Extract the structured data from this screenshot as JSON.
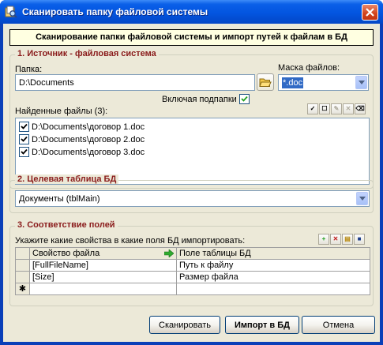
{
  "window": {
    "title": "Сканировать папку файловой системы",
    "close_glyph": "✕"
  },
  "banner": "Сканирование папки файловой системы и импорт путей к файлам в БД",
  "source": {
    "legend": "1. Источник - файловая система",
    "folder_label": "Папка:",
    "folder_value": "D:\\Documents",
    "mask_label": "Маска файлов:",
    "mask_value": "*.doc",
    "subfolders_label": "Включая подпапки",
    "subfolders_checked": true,
    "found_label": "Найденные файлы (3):",
    "toolbar": [
      "check-all",
      "uncheck-all",
      "edit",
      "delete",
      "clear"
    ],
    "files": [
      {
        "path": "D:\\Documents\\договор 1.doc",
        "checked": true
      },
      {
        "path": "D:\\Documents\\договор 2.doc",
        "checked": true
      },
      {
        "path": "D:\\Documents\\договор 3.doc",
        "checked": true
      }
    ]
  },
  "target": {
    "legend": "2. Целевая таблица БД",
    "table_value": "Документы (tblMain)"
  },
  "mapping": {
    "legend": "3. Соответствие полей",
    "hint": "Укажите какие свойства в какие поля БД импортировать:",
    "col_property": "Свойство файла",
    "col_field": "Поле таблицы БД",
    "rows": [
      {
        "property": "[FullFileName]",
        "field": "Путь к файлу"
      },
      {
        "property": "[Size]",
        "field": "Размер файла"
      }
    ],
    "new_row_marker": "✱"
  },
  "buttons": {
    "scan": "Сканировать",
    "import": "Импорт в БД",
    "cancel": "Отмена"
  },
  "colors": {
    "title_bar": "#0355e0",
    "legend_text": "#8a1b1b",
    "banner_bg": "#ffffe1",
    "selection": "#316ac5"
  }
}
